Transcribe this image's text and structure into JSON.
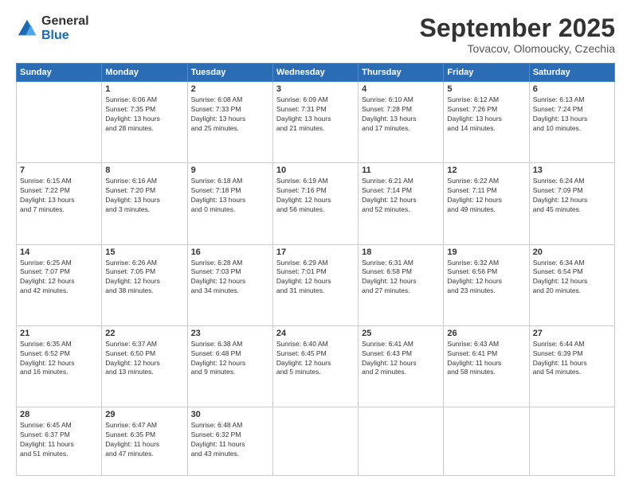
{
  "logo": {
    "general": "General",
    "blue": "Blue"
  },
  "title": "September 2025",
  "subtitle": "Tovacov, Olomoucky, Czechia",
  "days_header": [
    "Sunday",
    "Monday",
    "Tuesday",
    "Wednesday",
    "Thursday",
    "Friday",
    "Saturday"
  ],
  "weeks": [
    [
      {
        "day": "",
        "info": ""
      },
      {
        "day": "1",
        "info": "Sunrise: 6:06 AM\nSunset: 7:35 PM\nDaylight: 13 hours\nand 28 minutes."
      },
      {
        "day": "2",
        "info": "Sunrise: 6:08 AM\nSunset: 7:33 PM\nDaylight: 13 hours\nand 25 minutes."
      },
      {
        "day": "3",
        "info": "Sunrise: 6:09 AM\nSunset: 7:31 PM\nDaylight: 13 hours\nand 21 minutes."
      },
      {
        "day": "4",
        "info": "Sunrise: 6:10 AM\nSunset: 7:28 PM\nDaylight: 13 hours\nand 17 minutes."
      },
      {
        "day": "5",
        "info": "Sunrise: 6:12 AM\nSunset: 7:26 PM\nDaylight: 13 hours\nand 14 minutes."
      },
      {
        "day": "6",
        "info": "Sunrise: 6:13 AM\nSunset: 7:24 PM\nDaylight: 13 hours\nand 10 minutes."
      }
    ],
    [
      {
        "day": "7",
        "info": "Sunrise: 6:15 AM\nSunset: 7:22 PM\nDaylight: 13 hours\nand 7 minutes."
      },
      {
        "day": "8",
        "info": "Sunrise: 6:16 AM\nSunset: 7:20 PM\nDaylight: 13 hours\nand 3 minutes."
      },
      {
        "day": "9",
        "info": "Sunrise: 6:18 AM\nSunset: 7:18 PM\nDaylight: 13 hours\nand 0 minutes."
      },
      {
        "day": "10",
        "info": "Sunrise: 6:19 AM\nSunset: 7:16 PM\nDaylight: 12 hours\nand 56 minutes."
      },
      {
        "day": "11",
        "info": "Sunrise: 6:21 AM\nSunset: 7:14 PM\nDaylight: 12 hours\nand 52 minutes."
      },
      {
        "day": "12",
        "info": "Sunrise: 6:22 AM\nSunset: 7:11 PM\nDaylight: 12 hours\nand 49 minutes."
      },
      {
        "day": "13",
        "info": "Sunrise: 6:24 AM\nSunset: 7:09 PM\nDaylight: 12 hours\nand 45 minutes."
      }
    ],
    [
      {
        "day": "14",
        "info": "Sunrise: 6:25 AM\nSunset: 7:07 PM\nDaylight: 12 hours\nand 42 minutes."
      },
      {
        "day": "15",
        "info": "Sunrise: 6:26 AM\nSunset: 7:05 PM\nDaylight: 12 hours\nand 38 minutes."
      },
      {
        "day": "16",
        "info": "Sunrise: 6:28 AM\nSunset: 7:03 PM\nDaylight: 12 hours\nand 34 minutes."
      },
      {
        "day": "17",
        "info": "Sunrise: 6:29 AM\nSunset: 7:01 PM\nDaylight: 12 hours\nand 31 minutes."
      },
      {
        "day": "18",
        "info": "Sunrise: 6:31 AM\nSunset: 6:58 PM\nDaylight: 12 hours\nand 27 minutes."
      },
      {
        "day": "19",
        "info": "Sunrise: 6:32 AM\nSunset: 6:56 PM\nDaylight: 12 hours\nand 23 minutes."
      },
      {
        "day": "20",
        "info": "Sunrise: 6:34 AM\nSunset: 6:54 PM\nDaylight: 12 hours\nand 20 minutes."
      }
    ],
    [
      {
        "day": "21",
        "info": "Sunrise: 6:35 AM\nSunset: 6:52 PM\nDaylight: 12 hours\nand 16 minutes."
      },
      {
        "day": "22",
        "info": "Sunrise: 6:37 AM\nSunset: 6:50 PM\nDaylight: 12 hours\nand 13 minutes."
      },
      {
        "day": "23",
        "info": "Sunrise: 6:38 AM\nSunset: 6:48 PM\nDaylight: 12 hours\nand 9 minutes."
      },
      {
        "day": "24",
        "info": "Sunrise: 6:40 AM\nSunset: 6:45 PM\nDaylight: 12 hours\nand 5 minutes."
      },
      {
        "day": "25",
        "info": "Sunrise: 6:41 AM\nSunset: 6:43 PM\nDaylight: 12 hours\nand 2 minutes."
      },
      {
        "day": "26",
        "info": "Sunrise: 6:43 AM\nSunset: 6:41 PM\nDaylight: 11 hours\nand 58 minutes."
      },
      {
        "day": "27",
        "info": "Sunrise: 6:44 AM\nSunset: 6:39 PM\nDaylight: 11 hours\nand 54 minutes."
      }
    ],
    [
      {
        "day": "28",
        "info": "Sunrise: 6:45 AM\nSunset: 6:37 PM\nDaylight: 11 hours\nand 51 minutes."
      },
      {
        "day": "29",
        "info": "Sunrise: 6:47 AM\nSunset: 6:35 PM\nDaylight: 11 hours\nand 47 minutes."
      },
      {
        "day": "30",
        "info": "Sunrise: 6:48 AM\nSunset: 6:32 PM\nDaylight: 11 hours\nand 43 minutes."
      },
      {
        "day": "",
        "info": ""
      },
      {
        "day": "",
        "info": ""
      },
      {
        "day": "",
        "info": ""
      },
      {
        "day": "",
        "info": ""
      }
    ]
  ]
}
